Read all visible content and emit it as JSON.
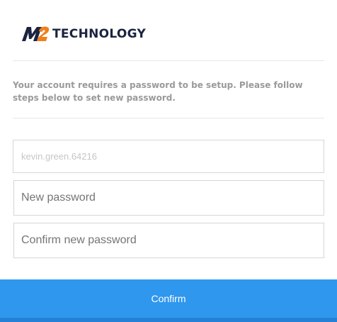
{
  "brand": {
    "logo_mark_icon": "m2-logo-icon",
    "name": "TECHNOLOGY",
    "colors": {
      "navy": "#1b2340",
      "orange": "#f07f1a"
    }
  },
  "instructions": "Your account requires a password to be setup. Please follow steps below to set new password.",
  "form": {
    "username_value": "kevin.green.64216",
    "new_password_placeholder": "New password",
    "confirm_password_placeholder": "Confirm new password"
  },
  "confirm_button": {
    "label": "Confirm",
    "color": "#2f97ee"
  }
}
